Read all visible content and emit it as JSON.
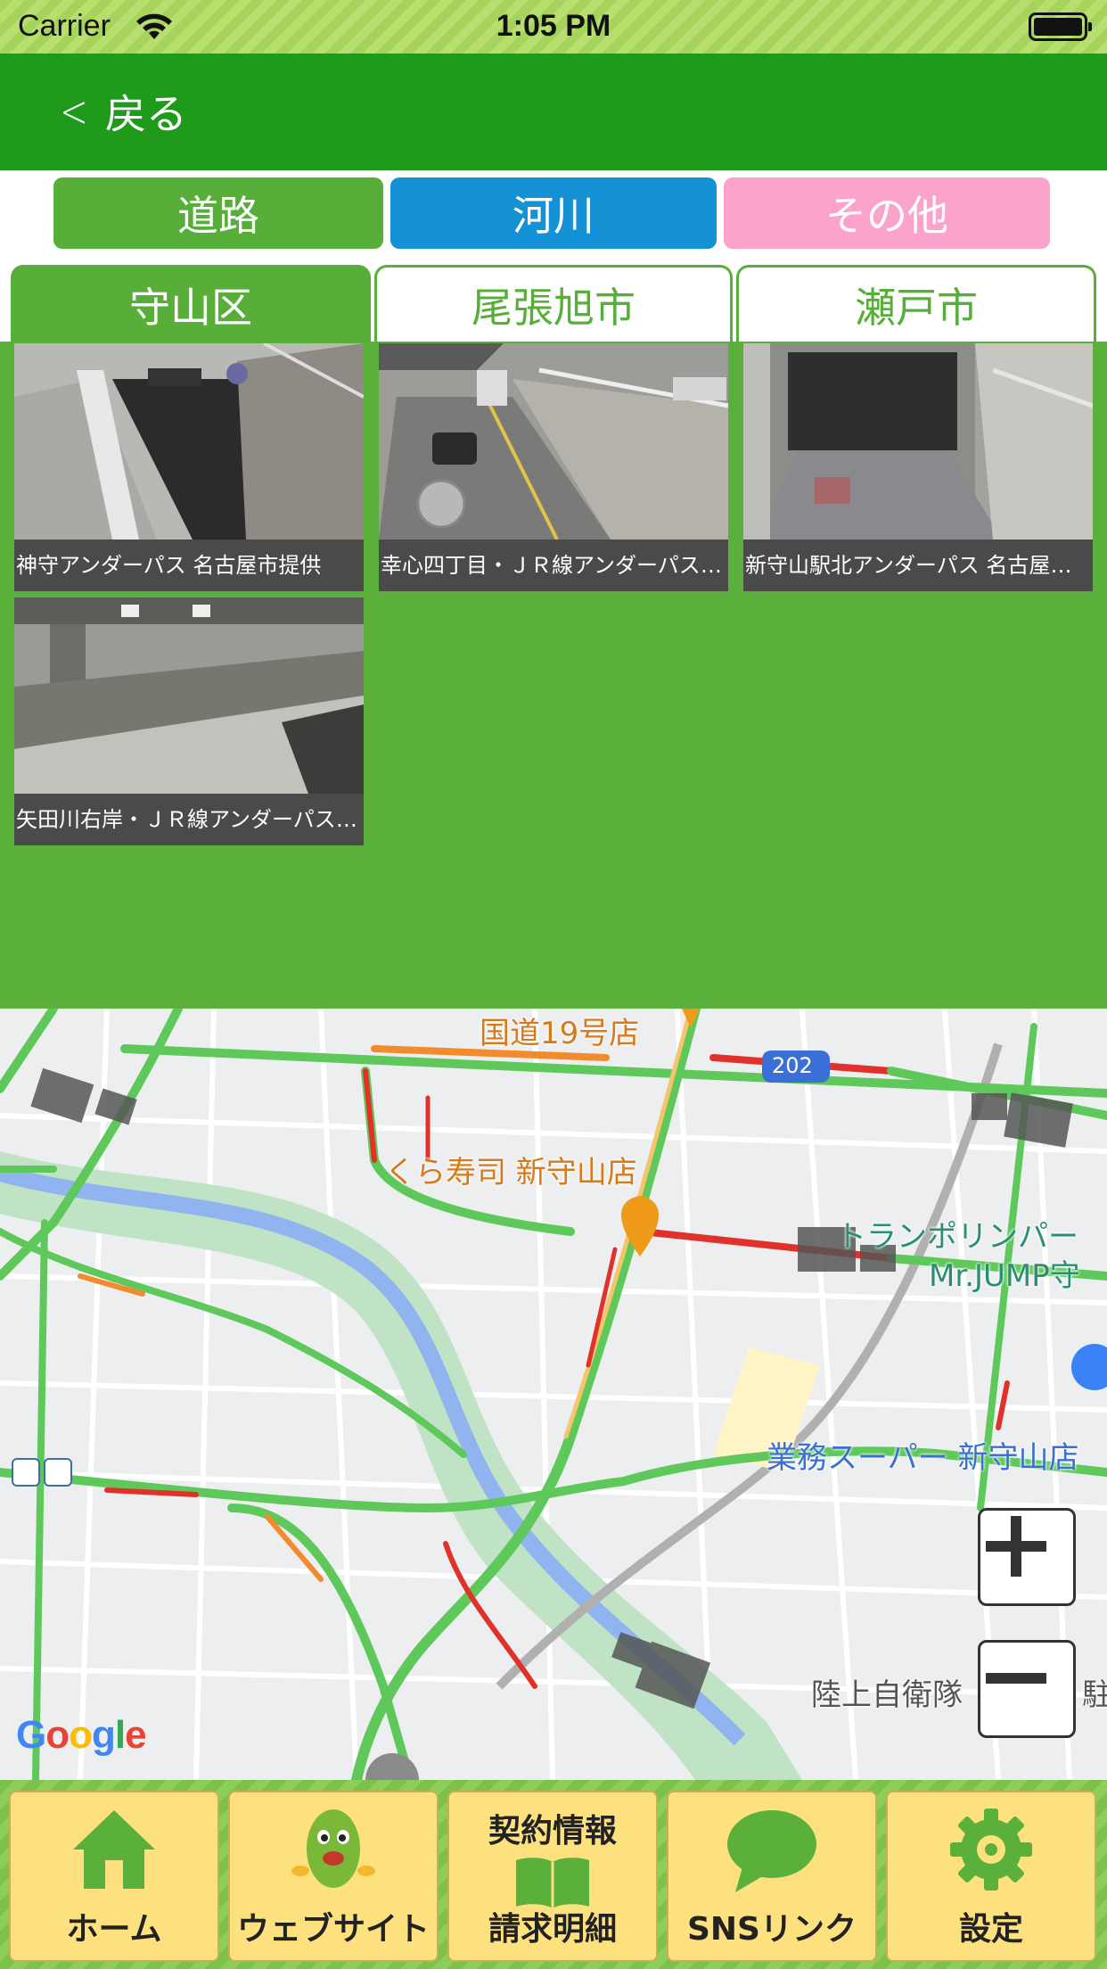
{
  "status_bar": {
    "carrier": "Carrier",
    "time": "1:05 PM"
  },
  "nav": {
    "back_label": "戻る"
  },
  "category_tabs": [
    {
      "label": "道路",
      "color": "#57af3a"
    },
    {
      "label": "河川",
      "color": "#1592d6"
    },
    {
      "label": "その他",
      "color": "#fba3cb"
    }
  ],
  "area_tabs": [
    {
      "label": "守山区",
      "selected": true
    },
    {
      "label": "尾張旭市",
      "selected": false
    },
    {
      "label": "瀬戸市",
      "selected": false
    }
  ],
  "cameras": [
    {
      "caption": "神守アンダーパス 名古屋市提供"
    },
    {
      "caption": "幸心四丁目・ＪＲ線アンダーパス 名古屋市提供"
    },
    {
      "caption": "新守山駅北アンダーパス 名古屋市提供"
    },
    {
      "caption": "矢田川右岸・ＪＲ線アンダーパス 名古屋市提供"
    }
  ],
  "map": {
    "labels": {
      "store_top": "国道19号店",
      "route_shield": "202",
      "sushi": "くら寿司 新守山店",
      "trampoline_1": "トランポリンパー",
      "trampoline_2": "Mr.JUMP守",
      "supermarket": "業務スーパー 新守山店",
      "jsdf": "陸上自衛隊",
      "jsdf_cut": "駐",
      "google": "Google"
    },
    "zoom_in": "+",
    "zoom_out": "−"
  },
  "bottom_tabs": [
    {
      "label": "ホーム",
      "icon": "home-icon"
    },
    {
      "label": "ウェブサイト",
      "icon": "mascot-icon"
    },
    {
      "label_top": "契約情報",
      "label": "請求明細",
      "icon": "book-icon"
    },
    {
      "label": "SNSリンク",
      "icon": "chat-bubble-icon"
    },
    {
      "label": "設定",
      "icon": "gear-icon"
    }
  ],
  "colors": {
    "nav_green": "#1f9a1b",
    "panel_green": "#5ab03a",
    "tab_yellow": "#fde17e"
  }
}
